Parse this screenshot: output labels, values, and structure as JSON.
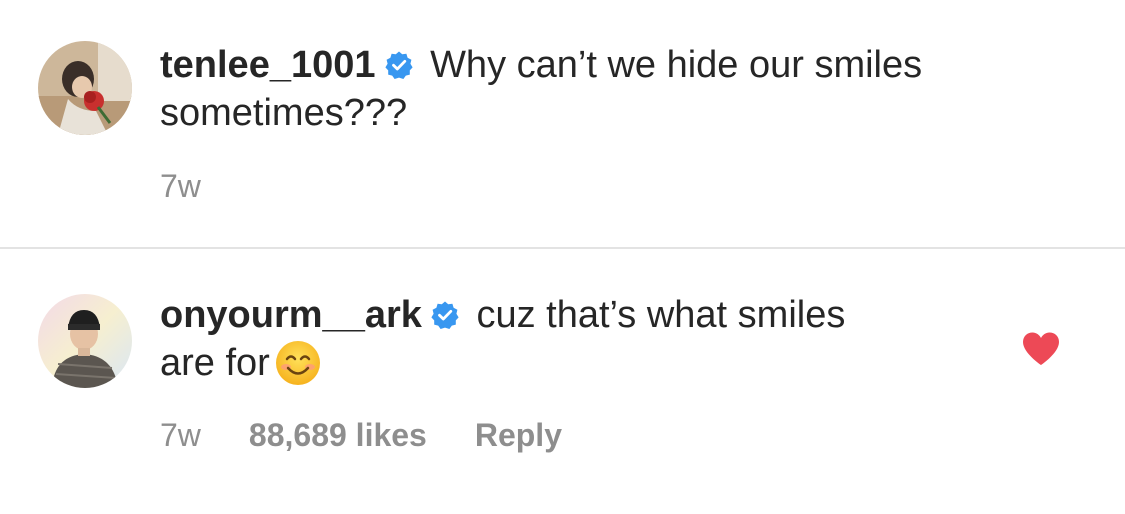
{
  "comments": [
    {
      "username": "tenlee_1001",
      "verified": true,
      "text_line1": "Why can’t we hide our smiles",
      "text_line2": "sometimes???",
      "time": "7w",
      "avatar_icon": "user-avatar-rose"
    },
    {
      "username": "onyourm__ark",
      "verified": true,
      "text_line1": "cuz that’s what smiles",
      "text_line2": "are for",
      "emoji": "smiling-face-emoji",
      "time": "7w",
      "likes": "88,689 likes",
      "reply_label": "Reply",
      "liked": true,
      "avatar_icon": "user-avatar-beanie"
    }
  ],
  "colors": {
    "text": "#262626",
    "meta": "#8e8e8e",
    "verified_blue": "#3897f0",
    "like_red": "#ed4956",
    "divider": "#e3e3e3"
  }
}
